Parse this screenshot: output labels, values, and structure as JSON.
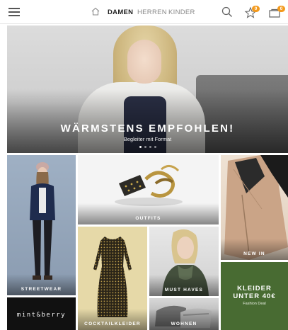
{
  "header": {
    "tabs": [
      {
        "label": "DAMEN",
        "active": true
      },
      {
        "label": "HERREN",
        "active": false
      },
      {
        "label": "KINDER",
        "active": false
      }
    ],
    "wishlist_count": "0",
    "cart_count": "0",
    "icons": [
      "menu-icon",
      "home-icon",
      "search-icon",
      "star-icon",
      "cart-icon"
    ]
  },
  "hero": {
    "title": "WÄRMSTENS EMPFOHLEN!",
    "subtitle": "Begleiter mit Format",
    "slides": 4,
    "active_slide": 1
  },
  "tiles": {
    "streetwear": "STREETWEAR",
    "outfits": "OUTFITS",
    "new_in": "NEW IN",
    "must_haves": "MUST HAVES",
    "cocktailkleider": "COCKTAILKLEIDER",
    "wohnen": "WOHNEN",
    "kleider_line1": "KLEIDER",
    "kleider_line2": "UNTER 40€",
    "kleider_sub": "Fashion Deal",
    "mint_berry": "mint&berry"
  },
  "colors": {
    "accent": "#f39a1e",
    "kleider_bg": "#486b32"
  }
}
